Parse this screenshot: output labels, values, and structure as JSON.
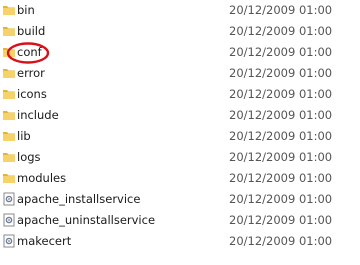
{
  "files": [
    {
      "name": "bin",
      "date": "20/12/2009 01:00",
      "type": "folder"
    },
    {
      "name": "build",
      "date": "20/12/2009 01:00",
      "type": "folder"
    },
    {
      "name": "conf",
      "date": "20/12/2009 01:00",
      "type": "folder"
    },
    {
      "name": "error",
      "date": "20/12/2009 01:00",
      "type": "folder"
    },
    {
      "name": "icons",
      "date": "20/12/2009 01:00",
      "type": "folder"
    },
    {
      "name": "include",
      "date": "20/12/2009 01:00",
      "type": "folder"
    },
    {
      "name": "lib",
      "date": "20/12/2009 01:00",
      "type": "folder"
    },
    {
      "name": "logs",
      "date": "20/12/2009 01:00",
      "type": "folder"
    },
    {
      "name": "modules",
      "date": "20/12/2009 01:00",
      "type": "folder"
    },
    {
      "name": "apache_installservice",
      "date": "20/12/2009 01:00",
      "type": "script"
    },
    {
      "name": "apache_uninstallservice",
      "date": "20/12/2009 01:00",
      "type": "script"
    },
    {
      "name": "makecert",
      "date": "20/12/2009 01:00",
      "type": "script"
    }
  ],
  "colors": {
    "folder": "#f6d26b",
    "folder_dark": "#e3b43c",
    "highlight": "#d8101a"
  },
  "icons": {
    "folder": "folder-icon",
    "script": "script-file-icon"
  }
}
